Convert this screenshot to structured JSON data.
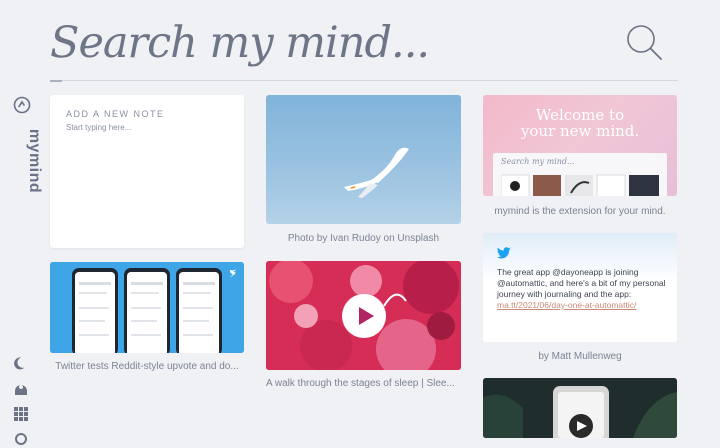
{
  "brand": {
    "name": "mymind"
  },
  "search": {
    "placeholder": "Search my mind..."
  },
  "note": {
    "title": "ADD A NEW NOTE",
    "placeholder": "Start typing here..."
  },
  "cards": {
    "bird_caption": "Photo by Ivan Rudoy on Unsplash",
    "welcome_title_1": "Welcome to",
    "welcome_title_2": "your new mind.",
    "welcome_mini_search": "Search my mind...",
    "welcome_caption": "mymind is the extension for your mind.",
    "tweet_text": "The great app @dayoneapp is joining @automattic, and here's a bit of my personal journey with journaling and the app:",
    "tweet_link": "ma.tt/2021/06/day-one-at-automattic/",
    "tweet_caption": "by Matt Mullenweg",
    "twitter_shots_caption": "Twitter tests Reddit-style upvote and do...",
    "sleep_caption": "A walk through the stages of sleep | Slee..."
  },
  "colors": {
    "background": "#eff1f5",
    "twitter_blue": "#1da1f2",
    "sleep_pink": "#d52d56"
  }
}
